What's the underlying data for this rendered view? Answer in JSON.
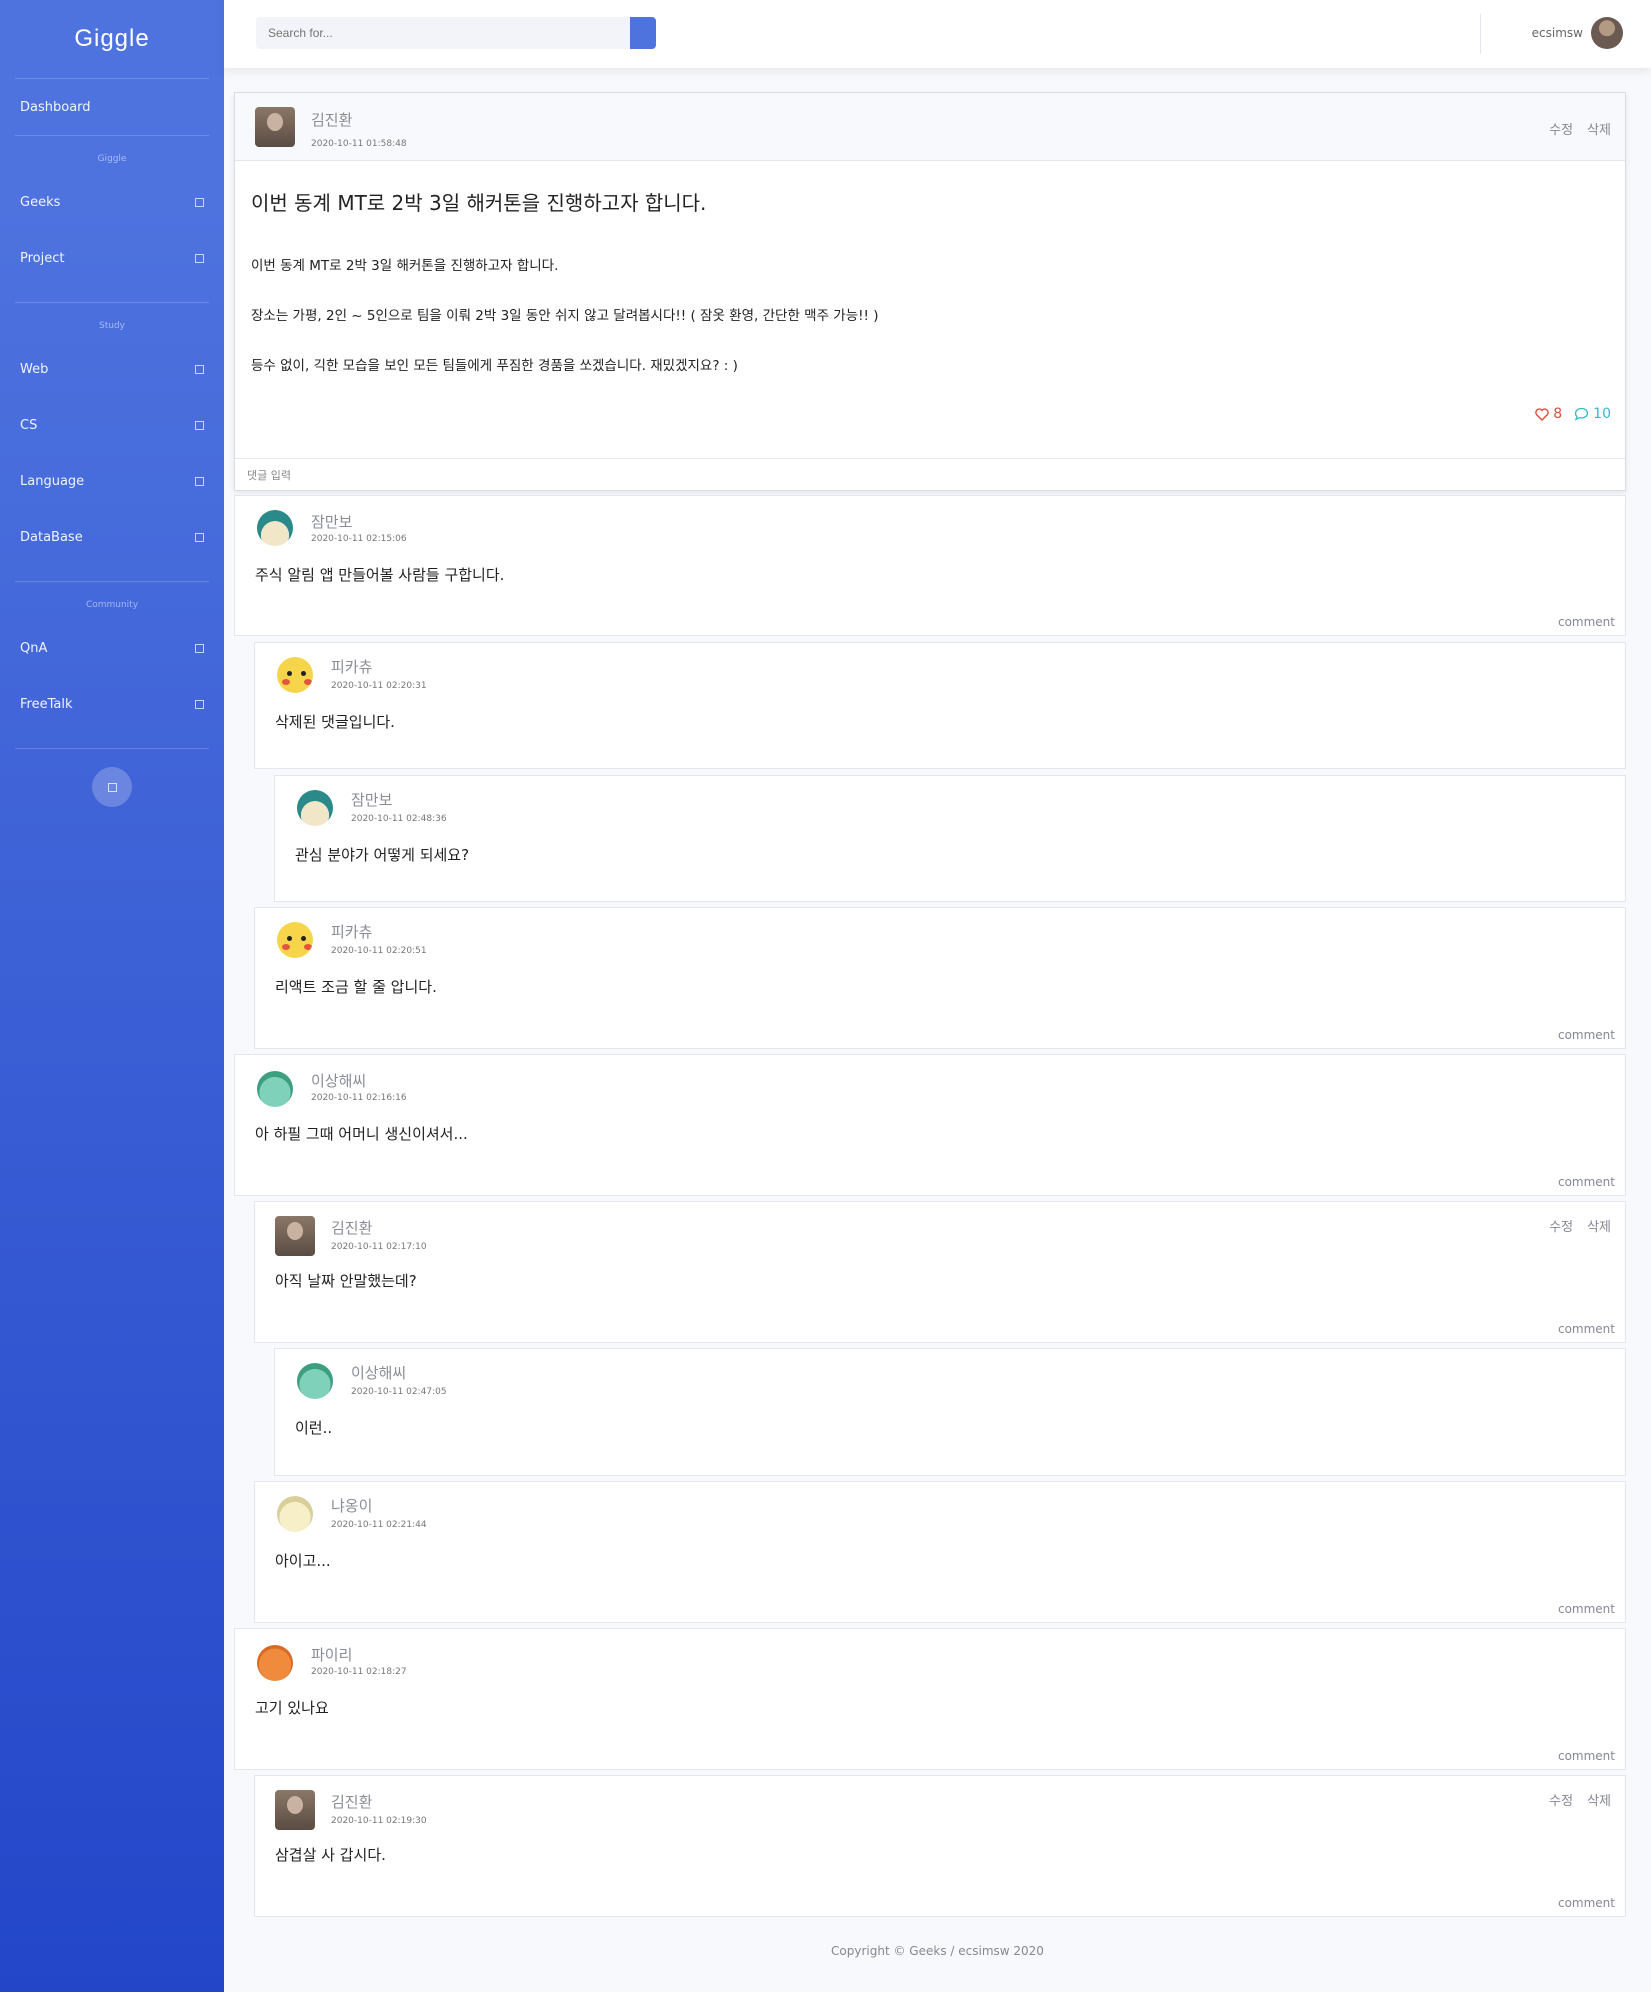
{
  "sidebar": {
    "brand": "Giggle",
    "dashboard": "Dashboard",
    "sections": [
      {
        "heading": "Giggle",
        "items": [
          "Geeks",
          "Project"
        ]
      },
      {
        "heading": "Study",
        "items": [
          "Web",
          "CS",
          "Language",
          "DataBase"
        ]
      },
      {
        "heading": "Community",
        "items": [
          "QnA",
          "FreeTalk"
        ]
      }
    ]
  },
  "topbar": {
    "search_placeholder": "Search for...",
    "username": "ecsimsw"
  },
  "post": {
    "author": "김진환",
    "date": "2020-10-11 01:58:48",
    "edit_label": "수정",
    "delete_label": "삭제",
    "title": "이번 동계 MT로 2박 3일 해커톤을 진행하고자 합니다.",
    "paragraphs": [
      "이번 동계 MT로 2박 3일 해커톤을 진행하고자 합니다.",
      "장소는 가평, 2인 ~ 5인으로 팀을 이뤄 2박 3일 동안 쉬지 않고 달려봅시다!! ( 잠옷 환영, 간단한 맥주 가능!! )",
      "등수 없이, 긱한 모습을 보인 모든 팀들에게 푸짐한 경품을 쏘겠습니다. 재밌겠지요? : )"
    ],
    "likes": "8",
    "comments": "10",
    "comment_input_placeholder": "댓글 입력"
  },
  "comments": [
    {
      "author": "잠만보",
      "date": "2020-10-11 02:15:06",
      "text": "주식 알림 앱 만들어볼 사람들 구합니다.",
      "comment_label": "comment"
    },
    {
      "author": "피카츄",
      "date": "2020-10-11 02:20:31",
      "text": "삭제된 댓글입니다."
    },
    {
      "author": "잠만보",
      "date": "2020-10-11 02:48:36",
      "text": "관심 분야가 어떻게 되세요?"
    },
    {
      "author": "피카츄",
      "date": "2020-10-11 02:20:51",
      "text": "리액트 조금 할 줄 압니다.",
      "comment_label": "comment"
    },
    {
      "author": "이상해씨",
      "date": "2020-10-11 02:16:16",
      "text": "아 하필 그때 어머니 생신이셔서...",
      "comment_label": "comment"
    },
    {
      "author": "김진환",
      "date": "2020-10-11 02:17:10",
      "text": "아직 날짜 안말했는데?",
      "edit_label": "수정",
      "delete_label": "삭제",
      "comment_label": "comment"
    },
    {
      "author": "이상해씨",
      "date": "2020-10-11 02:47:05",
      "text": "이런.."
    },
    {
      "author": "냐옹이",
      "date": "2020-10-11 02:21:44",
      "text": "아이고...",
      "comment_label": "comment"
    },
    {
      "author": "파이리",
      "date": "2020-10-11 02:18:27",
      "text": "고기 있나요",
      "comment_label": "comment"
    },
    {
      "author": "김진환",
      "date": "2020-10-11 02:19:30",
      "text": "삼겹살 사 갑시다.",
      "edit_label": "수정",
      "delete_label": "삭제",
      "comment_label": "comment"
    }
  ],
  "footer": "Copyright © Geeks / ecsimsw 2020",
  "colors": {
    "primary": "#4e73df",
    "like": "#e74a3b",
    "comment": "#36b9cc"
  }
}
